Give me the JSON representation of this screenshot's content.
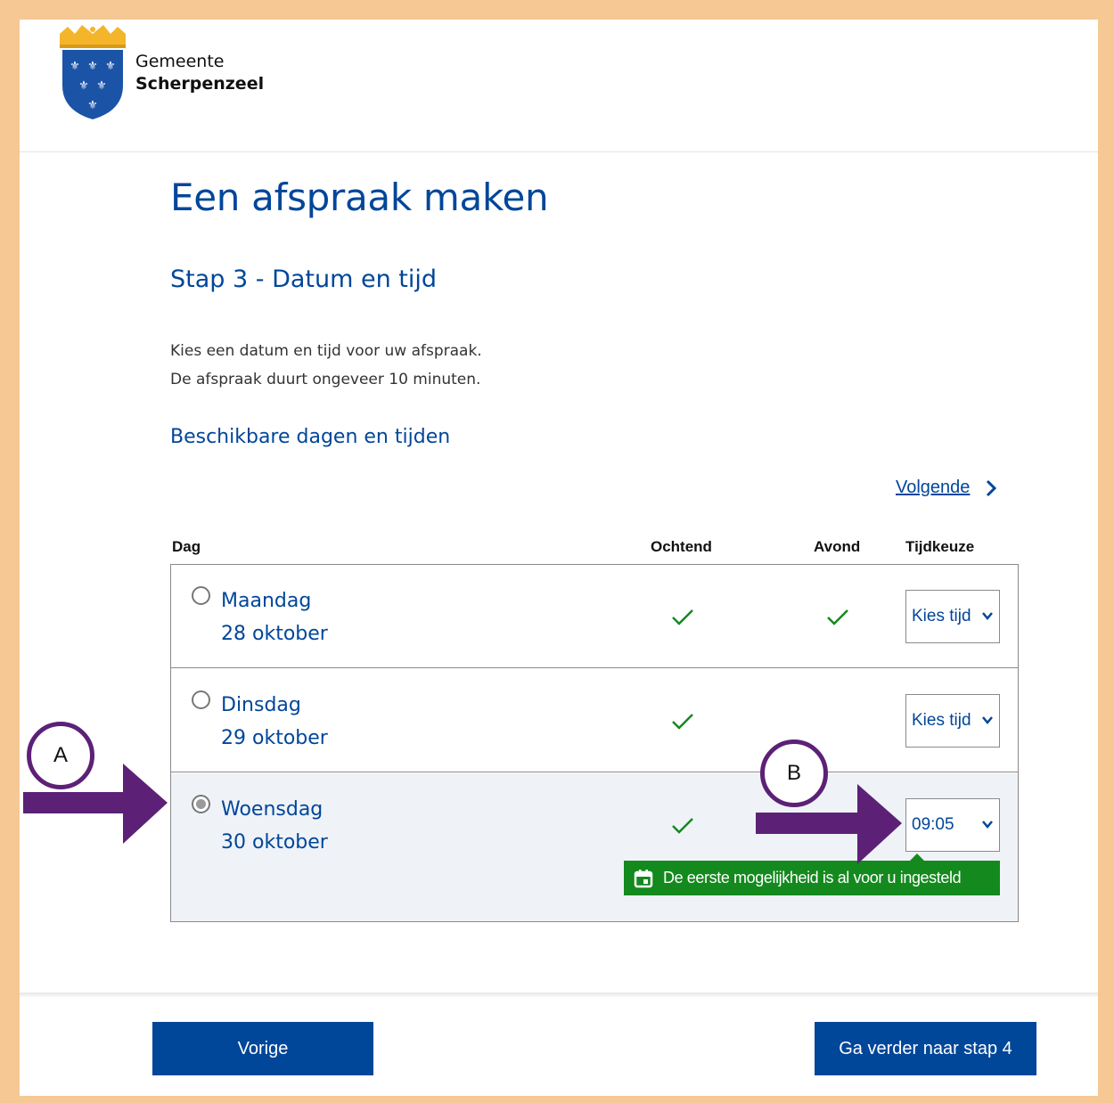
{
  "header": {
    "org_line1": "Gemeente",
    "org_line2": "Scherpenzeel"
  },
  "page": {
    "title": "Een afspraak maken",
    "step_title": "Stap 3 - Datum en tijd",
    "intro_line1": "Kies een datum en tijd voor uw afspraak.",
    "intro_line2": "De afspraak duurt ongeveer 10 minuten.",
    "section_title": "Beschikbare dagen en tijden",
    "next_link": "Volgende"
  },
  "table": {
    "headers": {
      "day": "Dag",
      "morning": "Ochtend",
      "evening": "Avond",
      "time": "Tijdkeuze"
    },
    "rows": [
      {
        "weekday": "Maandag",
        "date": "28 oktober",
        "morning": true,
        "evening": true,
        "selected": false,
        "time_value": "Kies tijd"
      },
      {
        "weekday": "Dinsdag",
        "date": "29 oktober",
        "morning": true,
        "evening": false,
        "selected": false,
        "time_value": "Kies tijd"
      },
      {
        "weekday": "Woensdag",
        "date": "30 oktober",
        "morning": true,
        "evening": false,
        "selected": true,
        "time_value": "09:05"
      }
    ],
    "tooltip": "De eerste mogelijkheid is al voor u ingesteld"
  },
  "footer": {
    "prev_label": "Vorige",
    "next_label": "Ga verder naar stap 4"
  },
  "annotations": {
    "a_label": "A",
    "b_label": "B"
  },
  "colors": {
    "brand_blue": "#004699",
    "success_green": "#14891e",
    "annotation_purple": "#5c2177",
    "frame_border": "#f5c894"
  }
}
